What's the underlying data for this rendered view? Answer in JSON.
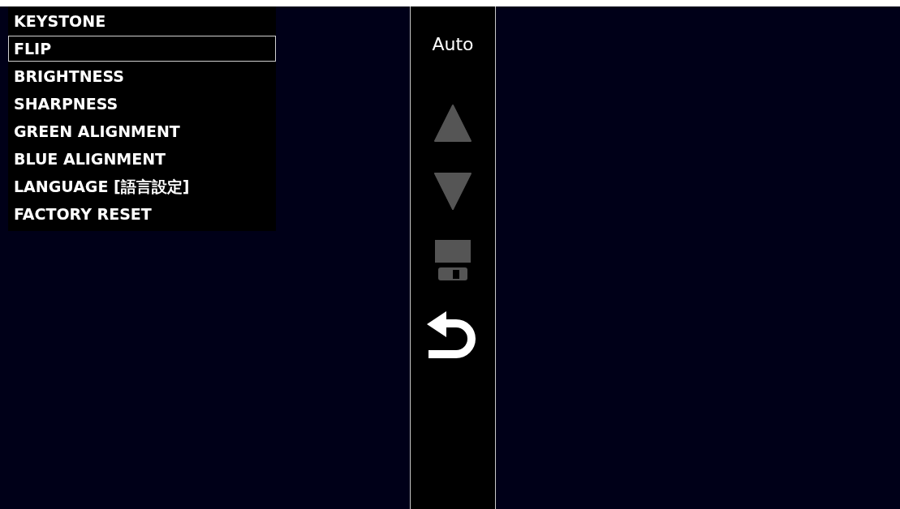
{
  "menu": {
    "items": [
      {
        "label": "KEYSTONE",
        "selected": false
      },
      {
        "label": "FLIP",
        "selected": true
      },
      {
        "label": "BRIGHTNESS",
        "selected": false
      },
      {
        "label": "SHARPNESS",
        "selected": false
      },
      {
        "label": "GREEN ALIGNMENT",
        "selected": false
      },
      {
        "label": "BLUE ALIGNMENT",
        "selected": false
      },
      {
        "label": "LANGUAGE [語言設定]",
        "selected": false
      },
      {
        "label": "FACTORY RESET",
        "selected": false
      }
    ]
  },
  "side_bar": {
    "mode": "Auto",
    "buttons": [
      {
        "kind": "up",
        "disabled": true
      },
      {
        "kind": "down",
        "disabled": true
      },
      {
        "kind": "save",
        "disabled": true
      },
      {
        "kind": "back",
        "disabled": false
      }
    ]
  }
}
